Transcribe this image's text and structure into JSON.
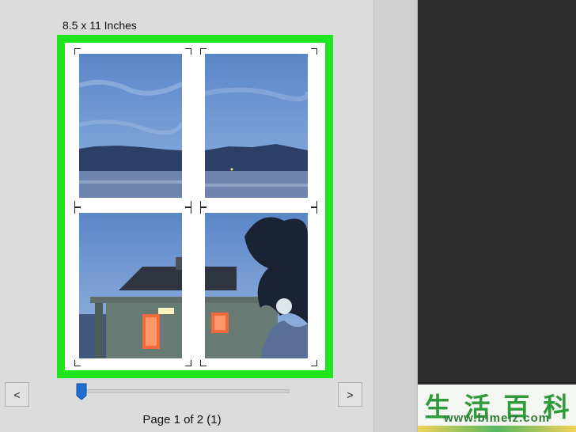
{
  "print_preview": {
    "paper_size_label": "8.5 x 11 Inches",
    "page_indicator": "Page 1 of 2 (1)",
    "prev_button_label": "<",
    "next_button_label": ">",
    "highlight_color": "#1fe51f"
  },
  "watermark": {
    "chars": [
      "生",
      "活",
      "百",
      "科"
    ],
    "url": "www.bimeiz.com"
  }
}
